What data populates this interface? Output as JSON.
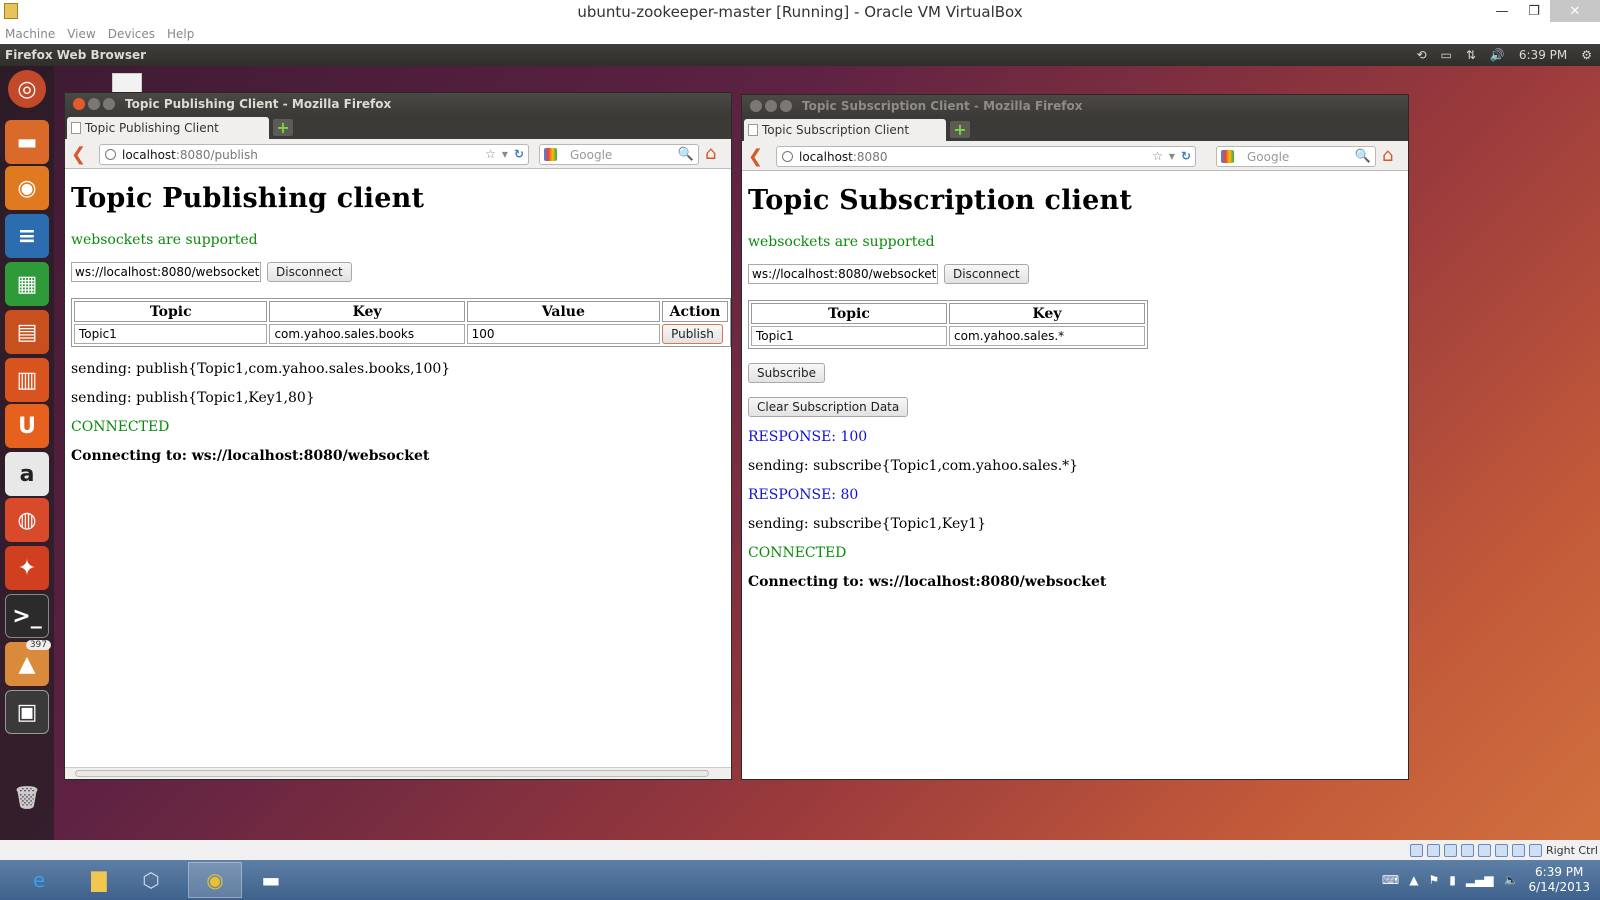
{
  "vbox": {
    "title": "ubuntu-zookeeper-master [Running] - Oracle VM VirtualBox",
    "menu": [
      "Machine",
      "View",
      "Devices",
      "Help"
    ],
    "status_hostkey": "Right Ctrl"
  },
  "ubuntu": {
    "panel_title": "Firefox Web Browser",
    "panel_time": "6:39 PM",
    "launcher_badge": "397"
  },
  "publisher": {
    "window_title": "Topic Publishing Client - Mozilla Firefox",
    "tab_label": "Topic Publishing Client",
    "url_host": "localhost",
    "url_rest": ":8080/publish",
    "search_placeholder": "Google",
    "heading": "Topic Publishing client",
    "support_msg": "websockets are supported",
    "ws_url": "ws://localhost:8080/websocket",
    "disconnect_label": "Disconnect",
    "headers": {
      "topic": "Topic",
      "key": "Key",
      "value": "Value",
      "action": "Action"
    },
    "row": {
      "topic": "Topic1",
      "key": "com.yahoo.sales.books",
      "value": "100",
      "action_label": "Publish"
    },
    "log": {
      "l1": "sending: publish{Topic1,com.yahoo.sales.books,100}",
      "l2": "sending: publish{Topic1,Key1,80}",
      "l3": "CONNECTED",
      "l4": "Connecting to: ws://localhost:8080/websocket"
    }
  },
  "subscriber": {
    "window_title": "Topic Subscription Client - Mozilla Firefox",
    "tab_label": "Topic Subscription Client",
    "url_host": "localhost",
    "url_rest": ":8080",
    "search_placeholder": "Google",
    "heading": "Topic Subscription client",
    "support_msg": "websockets are supported",
    "ws_url": "ws://localhost:8080/websocket",
    "disconnect_label": "Disconnect",
    "headers": {
      "topic": "Topic",
      "key": "Key"
    },
    "row": {
      "topic": "Topic1",
      "key": "com.yahoo.sales.*"
    },
    "subscribe_label": "Subscribe",
    "clear_label": "Clear Subscription Data",
    "log": {
      "l1": "RESPONSE: 100",
      "l2": "sending: subscribe{Topic1,com.yahoo.sales.*}",
      "l3": "RESPONSE: 80",
      "l4": "sending: subscribe{Topic1,Key1}",
      "l5": "CONNECTED",
      "l6": "Connecting to: ws://localhost:8080/websocket"
    }
  },
  "windows": {
    "clock_time": "6:39 PM",
    "clock_date": "6/14/2013"
  }
}
